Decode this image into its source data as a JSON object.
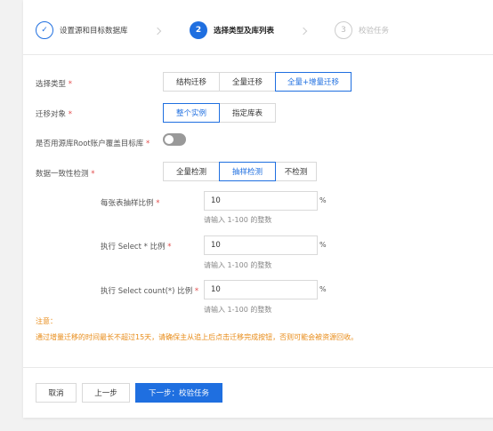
{
  "steps": [
    {
      "num": "✓",
      "label": "设置源和目标数据库",
      "state": "done"
    },
    {
      "num": "2",
      "label": "选择类型及库列表",
      "state": "active"
    },
    {
      "num": "3",
      "label": "校验任务",
      "state": "todo"
    }
  ],
  "form": {
    "type": {
      "label": "选择类型",
      "req": "*",
      "options": [
        "结构迁移",
        "全量迁移",
        "全量+增量迁移"
      ],
      "selected": "全量+增量迁移"
    },
    "object": {
      "label": "迁移对象",
      "req": "*",
      "options": [
        "整个实例",
        "指定库表"
      ],
      "selected": "整个实例"
    },
    "root": {
      "label": "是否用源库Root账户覆盖目标库",
      "req": "*",
      "on": false
    },
    "consistency": {
      "label": "数据一致性检测",
      "req": "*",
      "options": [
        "全量检测",
        "抽样检测",
        "不检测"
      ],
      "selected": "抽样检测"
    },
    "sample_ratio": {
      "label": "每张表抽样比例",
      "req": "*",
      "value": "10",
      "unit": "%",
      "hint": "请输入 1-100 的整数"
    },
    "select_ratio": {
      "label": "执行 Select * 比例",
      "req": "*",
      "value": "10",
      "unit": "%",
      "hint": "请输入 1-100 的整数"
    },
    "count_ratio": {
      "label": "执行 Select count(*) 比例",
      "req": "*",
      "value": "10",
      "unit": "%",
      "hint": "请输入 1-100 的整数"
    }
  },
  "note": {
    "title": "注意：",
    "text": "通过增量迁移的时间最长不超过15天，请确保主从追上后点击迁移完成按钮，否则可能会被资源回收。"
  },
  "footer": {
    "cancel": "取消",
    "prev": "上一步",
    "next": "下一步：校验任务"
  },
  "colors": {
    "accent": "#1f6fe0",
    "warning": "#e88b17",
    "required": "#e34d4d"
  }
}
